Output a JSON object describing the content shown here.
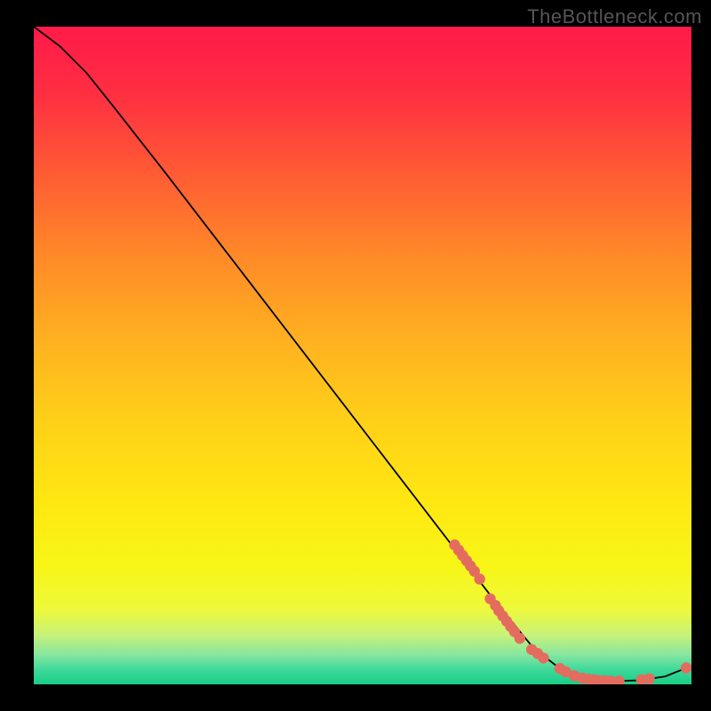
{
  "watermark": "TheBottleneck.com",
  "chart_data": {
    "type": "line",
    "title": "",
    "xlabel": "",
    "ylabel": "",
    "xlim": [
      0,
      100
    ],
    "ylim": [
      0,
      100
    ],
    "grid": false,
    "curve": [
      {
        "x": 0,
        "y": 100
      },
      {
        "x": 4,
        "y": 97
      },
      {
        "x": 8,
        "y": 93
      },
      {
        "x": 12,
        "y": 88
      },
      {
        "x": 20,
        "y": 77.8
      },
      {
        "x": 30,
        "y": 64.8
      },
      {
        "x": 40,
        "y": 51.8
      },
      {
        "x": 50,
        "y": 38.8
      },
      {
        "x": 60,
        "y": 25.8
      },
      {
        "x": 70,
        "y": 12.8
      },
      {
        "x": 76,
        "y": 5.5
      },
      {
        "x": 80,
        "y": 2.4
      },
      {
        "x": 84,
        "y": 0.9
      },
      {
        "x": 88,
        "y": 0.5
      },
      {
        "x": 92,
        "y": 0.6
      },
      {
        "x": 96,
        "y": 1.2
      },
      {
        "x": 100,
        "y": 2.8
      }
    ],
    "series": [
      {
        "name": "datapoints",
        "color": "#e46c5e",
        "points": [
          {
            "x": 64.0,
            "y": 21.2
          },
          {
            "x": 64.6,
            "y": 20.4
          },
          {
            "x": 65.2,
            "y": 19.6
          },
          {
            "x": 65.8,
            "y": 18.8
          },
          {
            "x": 66.4,
            "y": 18.0
          },
          {
            "x": 67.0,
            "y": 17.2
          },
          {
            "x": 67.8,
            "y": 16.0
          },
          {
            "x": 69.4,
            "y": 13.0
          },
          {
            "x": 70.2,
            "y": 12.0
          },
          {
            "x": 70.7,
            "y": 11.2
          },
          {
            "x": 71.3,
            "y": 10.4
          },
          {
            "x": 71.9,
            "y": 9.6
          },
          {
            "x": 72.5,
            "y": 8.8
          },
          {
            "x": 73.1,
            "y": 8.0
          },
          {
            "x": 73.9,
            "y": 7.0
          },
          {
            "x": 75.7,
            "y": 5.3
          },
          {
            "x": 76.6,
            "y": 4.7
          },
          {
            "x": 77.5,
            "y": 4.0
          },
          {
            "x": 80.0,
            "y": 2.4
          },
          {
            "x": 80.9,
            "y": 1.9
          },
          {
            "x": 82.2,
            "y": 1.3
          },
          {
            "x": 83.4,
            "y": 0.95
          },
          {
            "x": 84.3,
            "y": 0.8
          },
          {
            "x": 85.0,
            "y": 0.7
          },
          {
            "x": 85.8,
            "y": 0.6
          },
          {
            "x": 86.8,
            "y": 0.55
          },
          {
            "x": 87.7,
            "y": 0.5
          },
          {
            "x": 89.0,
            "y": 0.5
          },
          {
            "x": 92.4,
            "y": 0.7
          },
          {
            "x": 93.6,
            "y": 0.85
          },
          {
            "x": 99.2,
            "y": 2.5
          }
        ]
      }
    ]
  },
  "gradient": {
    "stops": [
      {
        "offset": 0.0,
        "color": "#ff1a4a"
      },
      {
        "offset": 0.1,
        "color": "#ff2e42"
      },
      {
        "offset": 0.22,
        "color": "#ff5a34"
      },
      {
        "offset": 0.35,
        "color": "#ff8a28"
      },
      {
        "offset": 0.48,
        "color": "#ffb220"
      },
      {
        "offset": 0.6,
        "color": "#ffd018"
      },
      {
        "offset": 0.72,
        "color": "#ffe712"
      },
      {
        "offset": 0.82,
        "color": "#f7f617"
      },
      {
        "offset": 0.885,
        "color": "#eef93a"
      },
      {
        "offset": 0.925,
        "color": "#c8f27a"
      },
      {
        "offset": 0.955,
        "color": "#86e6a0"
      },
      {
        "offset": 0.978,
        "color": "#3ed99a"
      },
      {
        "offset": 1.0,
        "color": "#17ce86"
      }
    ]
  }
}
